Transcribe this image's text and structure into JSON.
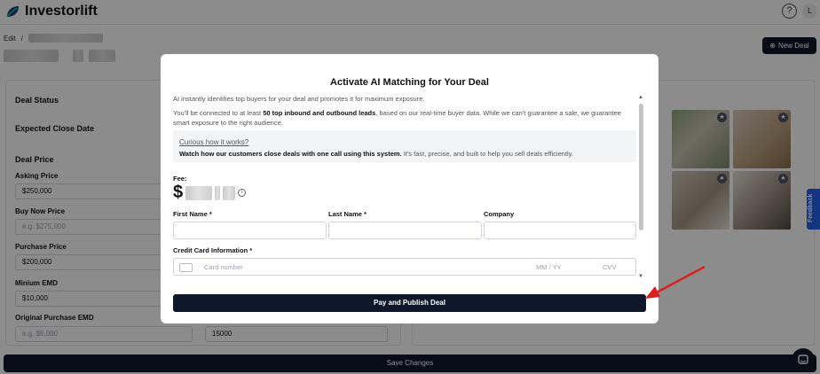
{
  "app": {
    "name": "Investorlift"
  },
  "topbar": {
    "help_icon": "?",
    "avatar_letter": "L"
  },
  "breadcrumb": {
    "edit": "Edit",
    "separator": "/"
  },
  "header": {
    "new_deal_label": "New Deal",
    "new_deal_icon": "plus-circle-icon"
  },
  "deal_form": {
    "deal_status_label": "Deal Status",
    "expected_close_label": "Expected Close Date",
    "deal_price_label": "Deal Price",
    "asking_price_label": "Asking Price",
    "asking_price_value": "$250,000",
    "buy_now_label": "Buy Now Price",
    "buy_now_placeholder": "e.g. $275,000",
    "purchase_price_label": "Purchase Price",
    "purchase_price_value": "$200,000",
    "min_emd_label": "Minium EMD",
    "min_emd_value": "$10,000",
    "orig_emd_label": "Original Purchase EMD",
    "orig_emd_placeholder": "e.g. $5,000",
    "right_field_value": "15000"
  },
  "feedback_tab": "Feedback",
  "save_label": "Save Changes",
  "modal": {
    "title": "Activate AI Matching for Your Deal",
    "intro": "AI instantly identifies top buyers for your deal and promotes it for maximum exposure.",
    "detail_pre": "You'll be connected to at least ",
    "detail_bold": "50 top inbound and outbound leads",
    "detail_post": ", based on our real-time buyer data. While we can't guarantee a sale, we guarantee smart exposure to the right audience.",
    "how_link": "Curious how it works?",
    "how_bold": "Watch how our customers close deals with one call using this system.",
    "how_rest": " It's fast, precise, and built to help you sell deals efficiently.",
    "fee_label": "Fee:",
    "fee_currency": "$",
    "first_name_label": "First Name *",
    "last_name_label": "Last Name *",
    "company_label": "Company",
    "cc_label": "Credit Card Information *",
    "cc_number_placeholder": "Card number",
    "cc_expiry_placeholder": "MM / YY",
    "cc_cvv_placeholder": "CVV",
    "pay_button": "Pay and Publish Deal"
  },
  "colors": {
    "primary_dark": "#0f172a",
    "feedback_blue": "#2563eb",
    "annotation_red": "#e11d1d"
  }
}
